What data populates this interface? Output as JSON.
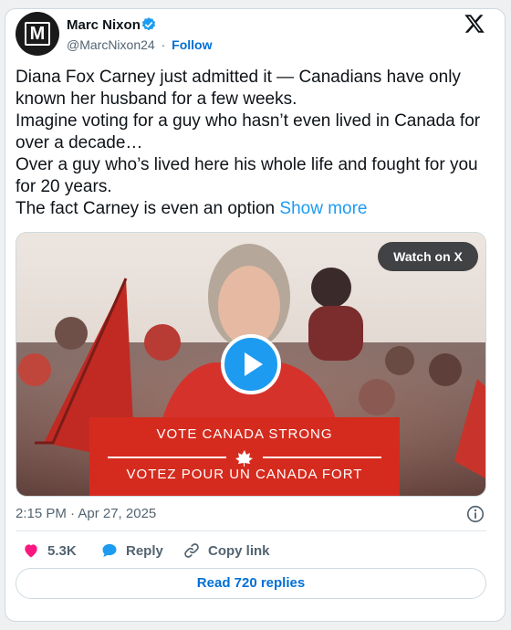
{
  "author": {
    "name": "Marc Nixon",
    "handle": "@MarcNixon24",
    "separator": "·",
    "follow_label": "Follow",
    "avatar_letter": "M"
  },
  "post": {
    "lines": [
      "Diana Fox Carney just admitted it — Canadians have only known her husband for a few weeks.",
      "Imagine voting for a guy who hasn’t even lived in Canada for over a decade…",
      "Over a guy who’s lived here his whole life and fought for you for 20 years.",
      "The fact Carney is even an option"
    ],
    "show_more": "Show more"
  },
  "media": {
    "watch_label": "Watch on X",
    "sign_line1": "VOTE CANADA STRONG",
    "sign_line2": "VOTEZ POUR UN CANADA FORT"
  },
  "meta": {
    "time": "2:15 PM · Apr 27, 2025"
  },
  "actions": {
    "likes": "5.3K",
    "reply_label": "Reply",
    "copy_label": "Copy link"
  },
  "read_replies": "Read 720 replies",
  "colors": {
    "accent": "#1d9bf0",
    "link": "#006fd6",
    "like": "#f91880",
    "secondary": "#536471",
    "sign_red": "#d52b1e"
  },
  "icons": [
    "verified-badge-icon",
    "x-logo-icon",
    "play-icon",
    "info-icon",
    "heart-icon",
    "reply-bubble-icon",
    "link-icon",
    "maple-leaf-icon"
  ]
}
